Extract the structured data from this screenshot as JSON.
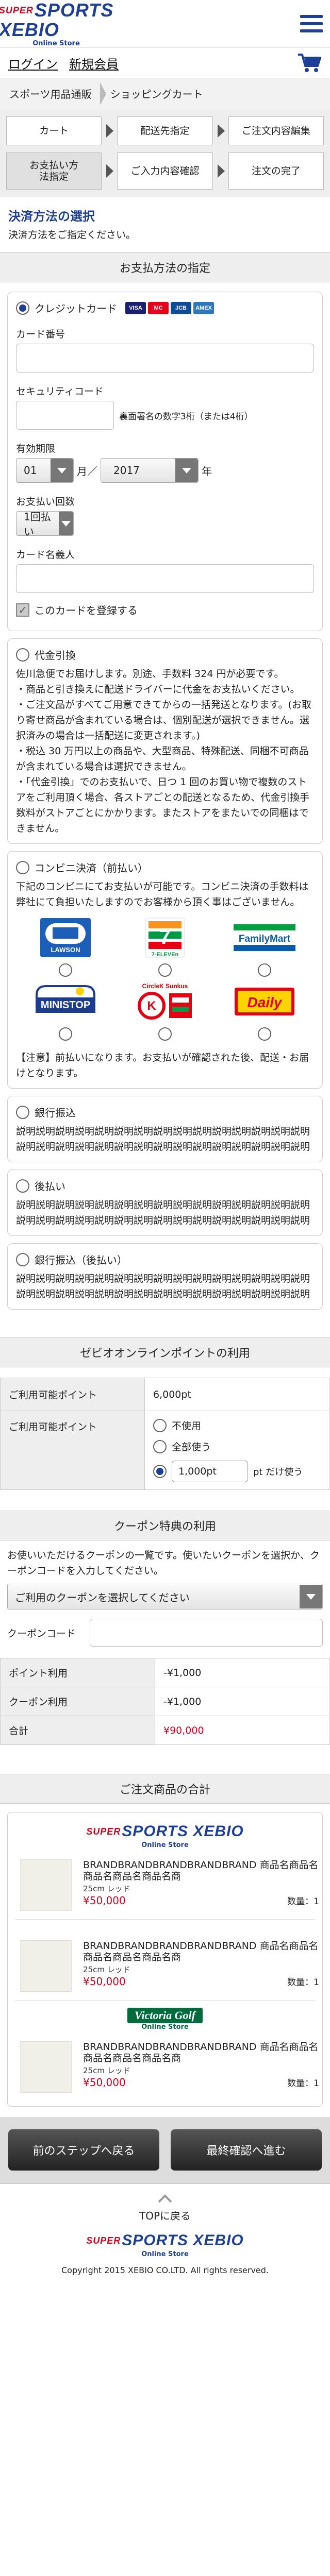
{
  "header": {
    "logo_sup": "SUPER",
    "logo_main": "SPORTS XEBIO",
    "logo_sub": "Online Store"
  },
  "user_nav": {
    "login": "ログイン",
    "register": "新規会員"
  },
  "breadcrumb": [
    "スポーツ用品通販",
    "ショッピングカート"
  ],
  "steps": [
    {
      "label": "カート",
      "active": false
    },
    {
      "label": "配送先指定",
      "active": false
    },
    {
      "label": "ご注文内容編集",
      "active": false
    },
    {
      "label": "お支払い方法指定",
      "active": true
    },
    {
      "label": "ご入力内容確認",
      "active": false
    },
    {
      "label": "注文の完了",
      "active": false
    }
  ],
  "section": {
    "title": "決済方法の選択",
    "note": "決済方法をご指定ください。"
  },
  "payment": {
    "bar_title": "お支払方法の指定",
    "credit": {
      "label": "クレジットカード",
      "card_brands": [
        "VISA",
        "MC",
        "JCB",
        "AMEX"
      ],
      "card_number_label": "カード番号",
      "security_label": "セキュリティコード",
      "security_note": "裏面署名の数字3桁（または4桁）",
      "expiry_label": "有効期限",
      "expiry_month": "01",
      "month_unit": "月／",
      "expiry_year": "2017",
      "year_unit": "年",
      "installments_label": "お支払い回数",
      "installments_value": "1回払い",
      "holder_label": "カード名義人",
      "save_label": "このカードを登録する"
    },
    "cod": {
      "label": "代金引換",
      "lines": [
        "佐川急便でお届けします。別途、手数料 324 円が必要です。",
        "・商品と引き換えに配送ドライバーに代金をお支払いください。",
        "・ご注文品がすべてご用意できてからの一括発送となります。(お取り寄せ商品が含まれている場合は、個別配送が選択できません。選択済みの場合は一括配送に変更されます。)",
        "・税込 30 万円以上の商品や、大型商品、特殊配送、同梱不可商品が含まれている場合は選択できません。",
        "・「代金引換」でのお支払いで、日つ 1 回のお買い物で複数のストアをご利用頂く場合、各ストアごとの配送となるため、代金引換手数料がストアごとにかかります。またストアをまたいでの同梱はできません。"
      ]
    },
    "convenience": {
      "label": "コンビニ決済（前払い）",
      "desc": "下記のコンビニにてお支払いが可能です。コンビニ決済の手数料は弊社にて負担いたしますのでお客様から頂く事はございません。",
      "stores": [
        "LAWSON",
        "7-ELEVEn",
        "FamilyMart",
        "MINISTOP",
        "CircleK Sunkus",
        "Daily"
      ],
      "note": "【注意】前払いになります。お支払いが確認された後、配送・お届けとなります。"
    },
    "bank": {
      "label": "銀行振込",
      "desc": "説明説明説明説明説明説明説明説明説明説明説明説明説明説明説明説明説明説明説明説明説明説明説明説明説明説明説明説明説明説明"
    },
    "deferred": {
      "label": "後払い",
      "desc": "説明説明説明説明説明説明説明説明説明説明説明説明説明説明説明説明説明説明説明説明説明説明説明説明説明説明説明説明説明説明"
    },
    "bank_deferred": {
      "label": "銀行振込（後払い）",
      "desc": "説明説明説明説明説明説明説明説明説明説明説明説明説明説明説明説明説明説明説明説明説明説明説明説明説明説明説明説明説明説明"
    }
  },
  "points": {
    "bar_title": "ゼビオオンラインポイントの利用",
    "available_label": "ご利用可能ポイント",
    "available_value": "6,000pt",
    "use_label": "ご利用可能ポイント",
    "options": [
      "不使用",
      "全部使う"
    ],
    "amount": "1,000pt",
    "amount_suffix": "pt だけ使う"
  },
  "coupon": {
    "bar_title": "クーポン特典の利用",
    "desc": "お使いいただけるクーポンの一覧です。使いたいクーポンを選択か、クーポンコードを入力してください。",
    "select_placeholder": "ご利用のクーポンを選択してください",
    "code_label": "クーポンコード"
  },
  "summary": {
    "rows": [
      {
        "label": "ポイント利用",
        "value": "-¥1,000"
      },
      {
        "label": "クーポン利用",
        "value": "-¥1,000"
      },
      {
        "label": "合計",
        "value": "¥90,000"
      }
    ]
  },
  "order": {
    "bar_title": "ご注文商品の合計",
    "store1": {
      "logo_sup": "SUPER",
      "logo_main": "SPORTS XEBIO",
      "logo_sub": "Online Store"
    },
    "store2": {
      "logo_main": "Victoria Golf",
      "logo_sub": "Online Store"
    },
    "items": [
      {
        "name": "BRANDBRANDBRANDBRANDBRAND 商品名商品名商品名商品名商品名商",
        "meta": "25cm レッド",
        "price": "¥50,000",
        "qty": "数量：1"
      },
      {
        "name": "BRANDBRANDBRANDBRANDBRAND 商品名商品名商品名商品名商品名商",
        "meta": "25cm レッド",
        "price": "¥50,000",
        "qty": "数量：1"
      },
      {
        "name": "BRANDBRANDBRANDBRANDBRAND 商品名商品名商品名商品名商品名商",
        "meta": "25cm レッド",
        "price": "¥50,000",
        "qty": "数量：1"
      }
    ]
  },
  "buttons": {
    "back": "前のステップへ戻る",
    "next": "最終確認へ進む"
  },
  "footer": {
    "top": "TOPに戻る",
    "logo_sup": "SUPER",
    "logo_main": "SPORTS XEBIO",
    "logo_sub": "Online Store",
    "copyright": "Copyright 2015 XEBIO CO.LTD. All rights reserved."
  }
}
